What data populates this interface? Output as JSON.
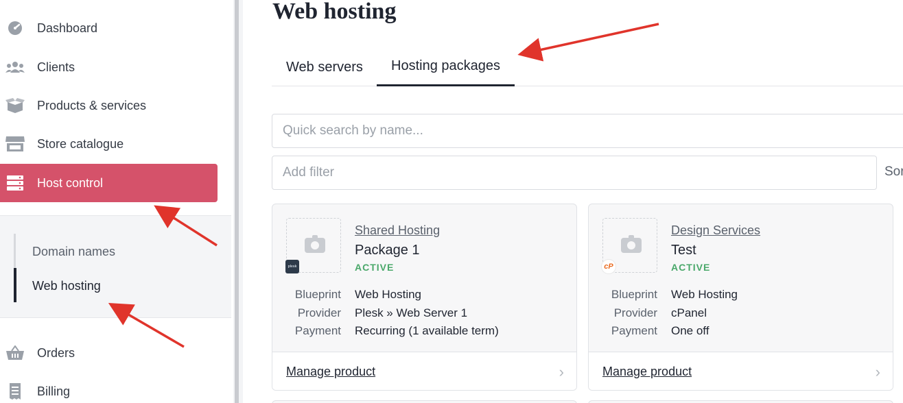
{
  "sidebar": {
    "items": [
      {
        "label": "Dashboard",
        "icon": "gauge-icon"
      },
      {
        "label": "Clients",
        "icon": "users-icon"
      },
      {
        "label": "Products & services",
        "icon": "box-icon"
      },
      {
        "label": "Store catalogue",
        "icon": "store-icon"
      },
      {
        "label": "Host control",
        "icon": "server-icon",
        "active": true
      },
      {
        "label": "Orders",
        "icon": "basket-icon"
      },
      {
        "label": "Billing",
        "icon": "receipt-icon"
      }
    ],
    "subnav": [
      {
        "label": "Domain names"
      },
      {
        "label": "Web hosting",
        "current": true
      }
    ]
  },
  "page": {
    "title": "Web hosting",
    "tabs": [
      {
        "label": "Web servers",
        "active": false
      },
      {
        "label": "Hosting packages",
        "active": true
      }
    ],
    "search_placeholder": "Quick search by name...",
    "filter_placeholder": "Add filter",
    "sort_label": "Sor"
  },
  "packages": [
    {
      "category": "Shared Hosting",
      "name": "Package 1",
      "status": "ACTIVE",
      "provider_badge": "plesk",
      "meta_keys": [
        "Blueprint",
        "Provider",
        "Payment"
      ],
      "meta_values": [
        "Web Hosting",
        "Plesk » Web Server 1",
        "Recurring (1 available term)"
      ],
      "action": "Manage product"
    },
    {
      "category": "Design Services",
      "name": "Test",
      "status": "ACTIVE",
      "provider_badge": "cP",
      "meta_keys": [
        "Blueprint",
        "Provider",
        "Payment"
      ],
      "meta_values": [
        "Web Hosting",
        "cPanel",
        "One off"
      ],
      "action": "Manage product"
    }
  ],
  "colors": {
    "accent": "#d5526a",
    "active_status": "#4aa86a",
    "annotation_arrow": "#e0342b"
  }
}
